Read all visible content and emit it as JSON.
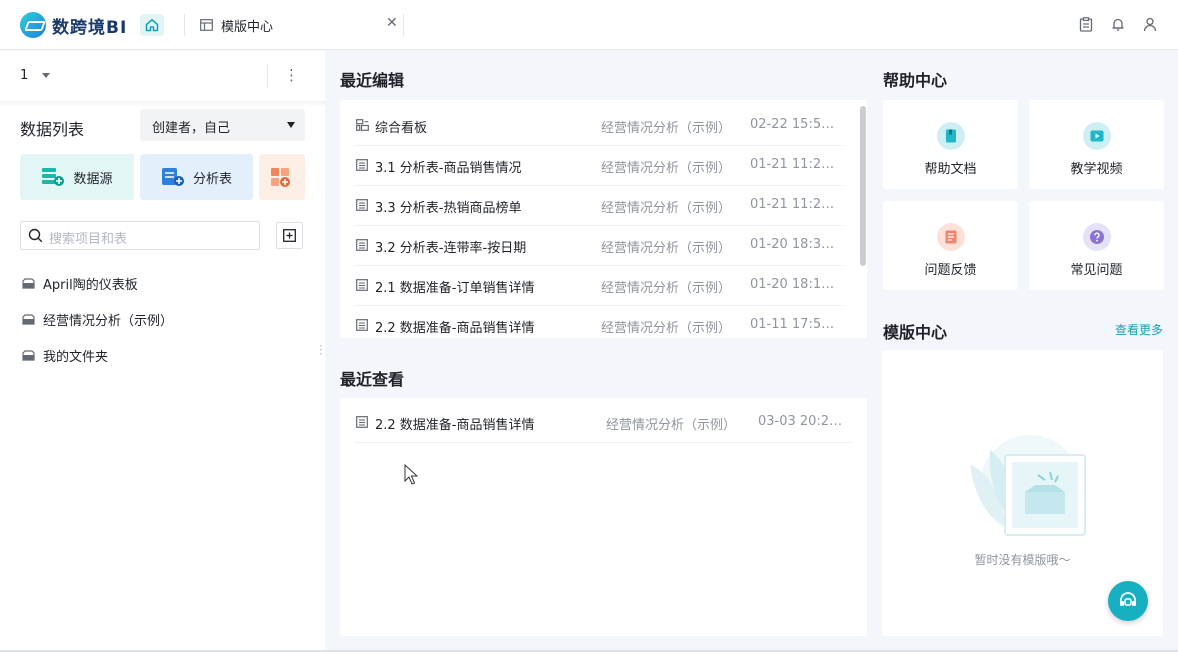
{
  "app": {
    "name": "数跨境BI",
    "brand_color": "#1a7fe0",
    "accent_color": "#16b0c2"
  },
  "tabs": [
    {
      "label": "模版中心",
      "icon": "template-icon"
    }
  ],
  "header_icons": [
    "clipboard-icon",
    "bell-icon",
    "user-icon"
  ],
  "sidebar": {
    "project": "1",
    "list_title": "数据列表",
    "creator_filter": "创建者，自己",
    "buttons": [
      {
        "label": "数据源",
        "icon": "datasource-icon"
      },
      {
        "label": "分析表",
        "icon": "analysis-table-icon"
      },
      {
        "label": "",
        "icon": "dashboard-add-icon"
      }
    ],
    "search_placeholder": "搜索项目和表",
    "folders": [
      "April陶的仪表板",
      "经营情况分析（示例）",
      "我的文件夹"
    ]
  },
  "recent_edit": {
    "title": "最近编辑",
    "rows": [
      {
        "name": "综合看板",
        "project": "经营情况分析（示例）",
        "time": "02-22 15:5…",
        "icon": "dashboard-icon"
      },
      {
        "name": "3.1  分析表-商品销售情况",
        "project": "经营情况分析（示例）",
        "time": "01-21 11:2…",
        "icon": "table-icon"
      },
      {
        "name": "3.3 分析表-热销商品榜单",
        "project": "经营情况分析（示例）",
        "time": "01-21 11:2…",
        "icon": "table-icon"
      },
      {
        "name": "3.2 分析表-连带率-按日期",
        "project": "经营情况分析（示例）",
        "time": "01-20 18:3…",
        "icon": "table-icon"
      },
      {
        "name": "2.1 数据准备-订单销售详情",
        "project": "经营情况分析（示例）",
        "time": "01-20 18:1…",
        "icon": "table-icon"
      },
      {
        "name": "2.2 数据准备-商品销售详情",
        "project": "经营情况分析（示例）",
        "time": "01-11 17:5…",
        "icon": "table-icon"
      }
    ]
  },
  "recent_view": {
    "title": "最近查看",
    "rows": [
      {
        "name": "2.2 数据准备-商品销售详情",
        "project": "经营情况分析（示例）",
        "time": "03-03 20:2…",
        "icon": "table-icon"
      }
    ]
  },
  "help": {
    "title": "帮助中心",
    "items": [
      {
        "label": "帮助文档",
        "icon": "help-doc-icon",
        "color": "#20b8c8"
      },
      {
        "label": "教学视频",
        "icon": "video-icon",
        "color": "#20b8c8"
      },
      {
        "label": "问题反馈",
        "icon": "feedback-icon",
        "color": "#f2846a"
      },
      {
        "label": "常见问题",
        "icon": "faq-icon",
        "color": "#8a72d6"
      }
    ]
  },
  "templates": {
    "title": "模版中心",
    "more_label": "查看更多",
    "empty_text": "暂时没有模版哦～"
  }
}
